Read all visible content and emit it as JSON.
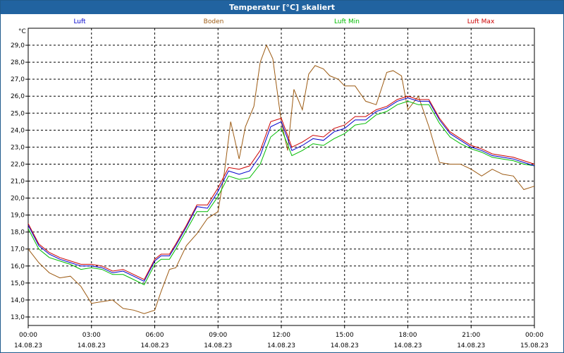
{
  "window": {
    "title": "Temperatur [°C] skaliert"
  },
  "chart_data": {
    "type": "line",
    "title": "Temperatur [°C] skaliert",
    "unit_label": "°C",
    "ylim": [
      12.5,
      30.0
    ],
    "yticks": [
      "13,0",
      "14,0",
      "15,0",
      "16,0",
      "17,0",
      "18,0",
      "19,0",
      "20,0",
      "21,0",
      "22,0",
      "23,0",
      "24,0",
      "25,0",
      "26,0",
      "27,0",
      "28,0",
      "29,0"
    ],
    "ytick_values": [
      13,
      14,
      15,
      16,
      17,
      18,
      19,
      20,
      21,
      22,
      23,
      24,
      25,
      26,
      27,
      28,
      29
    ],
    "xlim": [
      0,
      24
    ],
    "xticks": [
      {
        "time": "00:00",
        "date": "14.08.23",
        "hour": 0
      },
      {
        "time": "03:00",
        "date": "14.08.23",
        "hour": 3
      },
      {
        "time": "06:00",
        "date": "14.08.23",
        "hour": 6
      },
      {
        "time": "09:00",
        "date": "14.08.23",
        "hour": 9
      },
      {
        "time": "12:00",
        "date": "14.08.23",
        "hour": 12
      },
      {
        "time": "15:00",
        "date": "14.08.23",
        "hour": 15
      },
      {
        "time": "18:00",
        "date": "14.08.23",
        "hour": 18
      },
      {
        "time": "21:00",
        "date": "14.08.23",
        "hour": 21
      },
      {
        "time": "00:00",
        "date": "15.08.23",
        "hour": 24
      }
    ],
    "grid": true,
    "legend_position": "top",
    "series": [
      {
        "name": "Luft",
        "color": "#0000cc",
        "x": [
          0,
          0.5,
          1,
          1.5,
          2,
          2.5,
          3,
          3.5,
          4,
          4.5,
          5,
          5.5,
          6,
          6.3,
          6.7,
          7,
          7.5,
          8,
          8.5,
          9,
          9.5,
          10,
          10.5,
          11,
          11.5,
          12,
          12.5,
          13,
          13.5,
          14,
          14.5,
          15,
          15.5,
          16,
          16.5,
          17,
          17.5,
          18,
          18.5,
          19,
          19.5,
          20,
          20.5,
          21,
          21.5,
          22,
          22.5,
          23,
          23.5,
          24
        ],
        "y": [
          18.4,
          17.2,
          16.7,
          16.4,
          16.2,
          16.0,
          16.0,
          15.9,
          15.6,
          15.7,
          15.4,
          15.1,
          16.3,
          16.6,
          16.6,
          17.2,
          18.3,
          19.5,
          19.4,
          20.4,
          21.6,
          21.4,
          21.6,
          22.5,
          24.2,
          24.5,
          22.8,
          23.1,
          23.5,
          23.4,
          23.9,
          24.1,
          24.6,
          24.6,
          25.1,
          25.3,
          25.7,
          25.9,
          25.7,
          25.7,
          24.6,
          23.8,
          23.4,
          23.0,
          22.8,
          22.5,
          22.4,
          22.3,
          22.1,
          21.9
        ]
      },
      {
        "name": "Boden",
        "color": "#9c5a12",
        "x": [
          0,
          0.5,
          1,
          1.5,
          2,
          2.5,
          3,
          3.5,
          4,
          4.5,
          5,
          5.5,
          6,
          6.3,
          6.7,
          7,
          7.5,
          8,
          8.5,
          9,
          9.3,
          9.6,
          10,
          10.3,
          10.7,
          11,
          11.3,
          11.6,
          12,
          12.3,
          12.6,
          13,
          13.3,
          13.6,
          14,
          14.3,
          14.7,
          15,
          15.5,
          16,
          16.5,
          17,
          17.3,
          17.7,
          18,
          18.5,
          19,
          19.5,
          20,
          20.5,
          21,
          21.5,
          22,
          22.5,
          23,
          23.5,
          24
        ],
        "y": [
          17.0,
          16.2,
          15.6,
          15.3,
          15.4,
          14.8,
          13.8,
          13.9,
          14.0,
          13.5,
          13.4,
          13.2,
          13.4,
          14.5,
          15.8,
          15.9,
          17.2,
          17.9,
          18.8,
          19.2,
          21.5,
          24.5,
          22.3,
          24.2,
          25.4,
          28.0,
          29.0,
          28.2,
          24.5,
          22.8,
          26.4,
          25.2,
          27.3,
          27.8,
          27.6,
          27.2,
          27.0,
          26.6,
          26.6,
          25.7,
          25.5,
          27.4,
          27.5,
          27.2,
          25.2,
          26.0,
          24.2,
          22.1,
          22.0,
          22.0,
          21.7,
          21.3,
          21.7,
          21.4,
          21.3,
          20.5,
          20.7
        ]
      },
      {
        "name": "Luft Min",
        "color": "#00bb00",
        "x": [
          0,
          0.5,
          1,
          1.5,
          2,
          2.5,
          3,
          3.5,
          4,
          4.5,
          5,
          5.5,
          6,
          6.3,
          6.7,
          7,
          7.5,
          8,
          8.5,
          9,
          9.5,
          10,
          10.5,
          11,
          11.5,
          12,
          12.5,
          13,
          13.5,
          14,
          14.5,
          15,
          15.5,
          16,
          16.5,
          17,
          17.5,
          18,
          18.5,
          19,
          19.5,
          20,
          20.5,
          21,
          21.5,
          22,
          22.5,
          23,
          23.5,
          24
        ],
        "y": [
          18.2,
          17.0,
          16.5,
          16.3,
          16.1,
          15.8,
          15.9,
          15.8,
          15.5,
          15.5,
          15.2,
          14.9,
          16.1,
          16.4,
          16.4,
          17.0,
          18.1,
          19.2,
          19.2,
          20.1,
          21.3,
          21.1,
          21.2,
          22.0,
          23.6,
          24.1,
          22.5,
          22.8,
          23.2,
          23.1,
          23.5,
          23.8,
          24.3,
          24.4,
          24.9,
          25.1,
          25.5,
          25.7,
          25.5,
          25.5,
          24.4,
          23.6,
          23.2,
          22.9,
          22.7,
          22.4,
          22.3,
          22.2,
          22.0,
          21.9
        ]
      },
      {
        "name": "Luft Max",
        "color": "#cc0000",
        "x": [
          0,
          0.5,
          1,
          1.5,
          2,
          2.5,
          3,
          3.5,
          4,
          4.5,
          5,
          5.5,
          6,
          6.3,
          6.7,
          7,
          7.5,
          8,
          8.5,
          9,
          9.5,
          10,
          10.5,
          11,
          11.5,
          12,
          12.5,
          13,
          13.5,
          14,
          14.5,
          15,
          15.5,
          16,
          16.5,
          17,
          17.5,
          18,
          18.5,
          19,
          19.5,
          20,
          20.5,
          21,
          21.5,
          22,
          22.5,
          23,
          23.5,
          24
        ],
        "y": [
          18.5,
          17.3,
          16.8,
          16.5,
          16.3,
          16.1,
          16.1,
          16.0,
          15.7,
          15.8,
          15.5,
          15.2,
          16.4,
          16.7,
          16.7,
          17.3,
          18.4,
          19.6,
          19.6,
          20.6,
          21.8,
          21.7,
          21.9,
          22.8,
          24.5,
          24.7,
          23.0,
          23.3,
          23.7,
          23.6,
          24.1,
          24.3,
          24.8,
          24.8,
          25.2,
          25.4,
          25.8,
          26.0,
          25.8,
          25.8,
          24.7,
          23.9,
          23.5,
          23.1,
          22.9,
          22.6,
          22.5,
          22.4,
          22.2,
          22.0
        ]
      }
    ]
  }
}
